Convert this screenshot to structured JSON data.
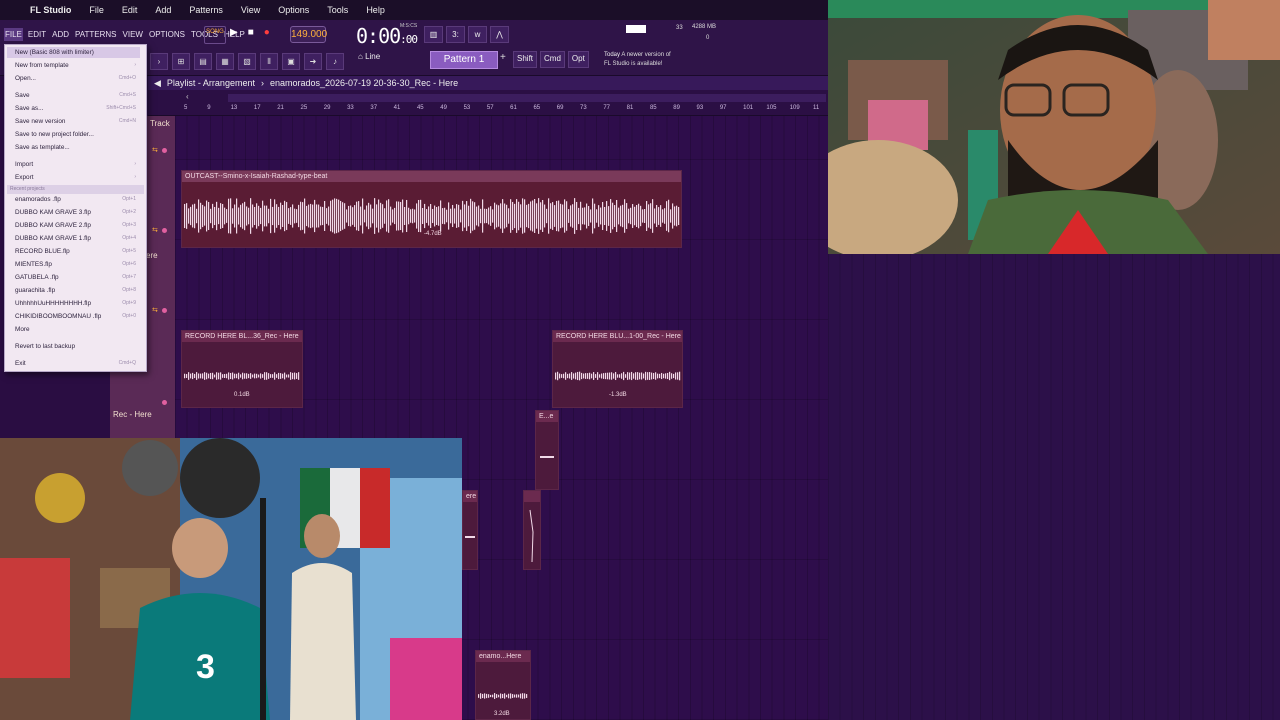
{
  "mac_menu": {
    "app": "FL Studio",
    "items": [
      "File",
      "Edit",
      "Add",
      "Patterns",
      "View",
      "Options",
      "Tools",
      "Help"
    ]
  },
  "fl_menu": [
    "FILE",
    "EDIT",
    "ADD",
    "PATTERNS",
    "VIEW",
    "OPTIONS",
    "TOOLS",
    "HELP"
  ],
  "toolbar": {
    "song_toggle": "SONG",
    "tempo": "149.000",
    "time": "0:00",
    "time_small": ":00",
    "time_label": "M:S:CS",
    "cpu_num": "33",
    "memory": "4288 MB",
    "poly": "0",
    "snap": "Line",
    "pattern": "Pattern 1",
    "pattern_add": "+",
    "mod_keys": [
      "Shift",
      "Cmd",
      "Opt"
    ],
    "news_today": "Today",
    "news_text1": "A newer version of",
    "news_text2": "FL Studio is available!"
  },
  "playlist": {
    "title": "Playlist - Arrangement",
    "separator": "›",
    "project": "enamorados_2026-07-19 20-36-30_Rec - Here",
    "ruler_numbers": [
      "5",
      "9",
      "13",
      "17",
      "21",
      "25",
      "29",
      "33",
      "37",
      "41",
      "45",
      "49",
      "53",
      "57",
      "61",
      "65",
      "69",
      "73",
      "77",
      "81",
      "85",
      "89",
      "93",
      "97",
      "101",
      "105",
      "109",
      "11"
    ]
  },
  "tracks": {
    "track_label": "Track",
    "ere_label": "ere",
    "rec_label": "Rec - Here"
  },
  "clips": {
    "outcast": {
      "title": "OUTCAST--Smino-x-Isaiah-Rashad-type-beat",
      "gain": "-4.7dB"
    },
    "rec1": {
      "title": "RECORD HERE BL...36_Rec - Here",
      "gain": "0.1dB"
    },
    "rec2": {
      "title": "RECORD HERE BLU...1-00_Rec - Here",
      "gain": "-1.3dB"
    },
    "small1": {
      "title": "E...e"
    },
    "small2": {
      "title": "ere"
    },
    "enamo": {
      "title": "enamo...Here",
      "gain": "3.2dB"
    }
  },
  "file_menu": {
    "items": [
      {
        "label": "New (Basic 808 with limiter)",
        "shortcut": ""
      },
      {
        "label": "New from template",
        "shortcut": "›"
      },
      {
        "label": "Open...",
        "shortcut": "Cmd+O"
      },
      {
        "label": "Save",
        "shortcut": "Cmd+S"
      },
      {
        "label": "Save as...",
        "shortcut": "Shift+Cmd+S"
      },
      {
        "label": "Save new version",
        "shortcut": "Cmd+N"
      },
      {
        "label": "Save to new project folder...",
        "shortcut": ""
      },
      {
        "label": "Save as template...",
        "shortcut": ""
      },
      {
        "label": "Import",
        "shortcut": "›"
      },
      {
        "label": "Export",
        "shortcut": "›"
      }
    ],
    "recent_header": "Recent projects",
    "recent": [
      {
        "label": "enamorados .flp",
        "shortcut": "Opt+1"
      },
      {
        "label": "DUBBO KAM GRAVE 3.flp",
        "shortcut": "Opt+2"
      },
      {
        "label": "DUBBO KAM GRAVE 2.flp",
        "shortcut": "Opt+3"
      },
      {
        "label": "DUBBO KAM GRAVE 1.flp",
        "shortcut": "Opt+4"
      },
      {
        "label": "RECORD BLUE.flp",
        "shortcut": "Opt+5"
      },
      {
        "label": "MIENTES.flp",
        "shortcut": "Opt+6"
      },
      {
        "label": "GATUBELA .flp",
        "shortcut": "Opt+7"
      },
      {
        "label": "guarachita .flp",
        "shortcut": "Opt+8"
      },
      {
        "label": "UhhhhhUuHHHHHHHH.flp",
        "shortcut": "Opt+9"
      },
      {
        "label": "CHIKIDIBOOMBOOMNAU .flp",
        "shortcut": "Opt+0"
      }
    ],
    "more": "More",
    "revert": "Revert to last backup",
    "exit": "Exit",
    "exit_shortcut": "Cmd+Q"
  },
  "colors": {
    "accent": "#ffb13b",
    "clip": "#4d1a3c",
    "playlist_bg": "#2e0d4b",
    "pattern": "#8a5cc0"
  }
}
